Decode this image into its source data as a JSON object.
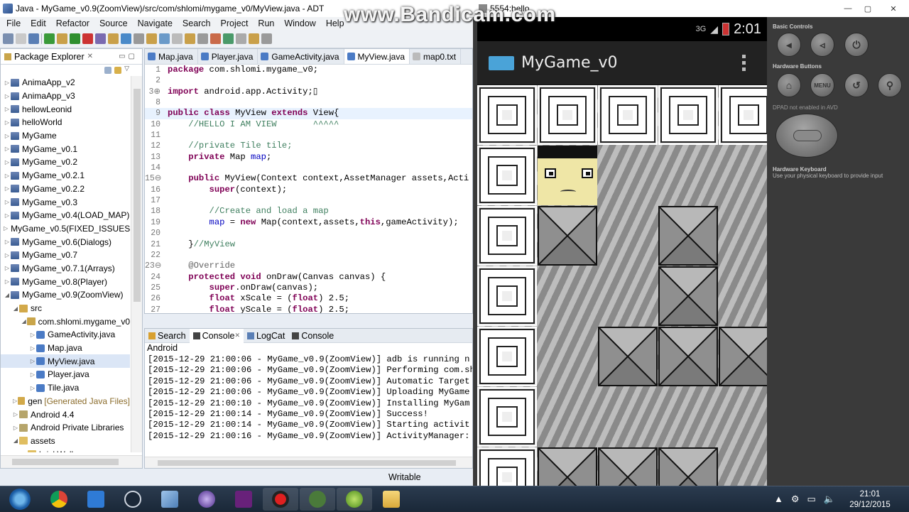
{
  "eclipse": {
    "title": "Java - MyGame_v0.9(ZoomView)/src/com/shlomi/mygame_v0/MyView.java - ADT",
    "menu": [
      "File",
      "Edit",
      "Refactor",
      "Source",
      "Navigate",
      "Search",
      "Project",
      "Run",
      "Window",
      "Help"
    ],
    "package_explorer": {
      "tab_label": "Package Explorer",
      "items": [
        {
          "label": "AnimaApp_v2",
          "kind": "proj",
          "arrow": "▷",
          "indent": 0
        },
        {
          "label": "AnimaApp_v3",
          "kind": "proj",
          "arrow": "▷",
          "indent": 0
        },
        {
          "label": "hellowLeonid",
          "kind": "proj",
          "arrow": "▷",
          "indent": 0
        },
        {
          "label": "helloWorld",
          "kind": "proj",
          "arrow": "▷",
          "indent": 0
        },
        {
          "label": "MyGame",
          "kind": "proj",
          "arrow": "▷",
          "indent": 0
        },
        {
          "label": "MyGame_v0.1",
          "kind": "proj",
          "arrow": "▷",
          "indent": 0
        },
        {
          "label": "MyGame_v0.2",
          "kind": "proj",
          "arrow": "▷",
          "indent": 0
        },
        {
          "label": "MyGame_v0.2.1",
          "kind": "proj",
          "arrow": "▷",
          "indent": 0
        },
        {
          "label": "MyGame_v0.2.2",
          "kind": "proj",
          "arrow": "▷",
          "indent": 0
        },
        {
          "label": "MyGame_v0.3",
          "kind": "proj",
          "arrow": "▷",
          "indent": 0
        },
        {
          "label": "MyGame_v0.4(LOAD_MAP)",
          "kind": "proj",
          "arrow": "▷",
          "indent": 0
        },
        {
          "label": "MyGame_v0.5(FIXED_ISSUES",
          "kind": "proj",
          "arrow": "▷",
          "indent": 0
        },
        {
          "label": "MyGame_v0.6(Dialogs)",
          "kind": "proj",
          "arrow": "▷",
          "indent": 0
        },
        {
          "label": "MyGame_v0.7",
          "kind": "proj",
          "arrow": "▷",
          "indent": 0
        },
        {
          "label": "MyGame_v0.7.1(Arrays)",
          "kind": "proj",
          "arrow": "▷",
          "indent": 0
        },
        {
          "label": "MyGame_v0.8(Player)",
          "kind": "proj",
          "arrow": "▷",
          "indent": 0
        },
        {
          "label": "MyGame_v0.9(ZoomView)",
          "kind": "proj",
          "arrow": "◢",
          "indent": 0
        },
        {
          "label": "src",
          "kind": "src",
          "arrow": "◢",
          "indent": 1
        },
        {
          "label": "com.shlomi.mygame_v0",
          "kind": "pkgf",
          "arrow": "◢",
          "indent": 2
        },
        {
          "label": "GameActivity.java",
          "kind": "java",
          "arrow": "▷",
          "indent": 3
        },
        {
          "label": "Map.java",
          "kind": "java",
          "arrow": "▷",
          "indent": 3
        },
        {
          "label": "MyView.java",
          "kind": "java",
          "arrow": "▷",
          "indent": 3,
          "selected": true
        },
        {
          "label": "Player.java",
          "kind": "java",
          "arrow": "▷",
          "indent": 3
        },
        {
          "label": "Tile.java",
          "kind": "java",
          "arrow": "▷",
          "indent": 3
        },
        {
          "label": "gen",
          "kind": "src",
          "arrow": "▷",
          "indent": 1,
          "suffix": "[Generated Java Files]"
        },
        {
          "label": "Android 4.4",
          "kind": "lib",
          "arrow": "▷",
          "indent": 1
        },
        {
          "label": "Android Private Libraries",
          "kind": "lib",
          "arrow": "▷",
          "indent": 1
        },
        {
          "label": "assets",
          "kind": "folder",
          "arrow": "◢",
          "indent": 1
        },
        {
          "label": "brickWall.png",
          "kind": "folder",
          "arrow": "",
          "indent": 2
        }
      ]
    },
    "editor": {
      "tabs": [
        "Map.java",
        "Player.java",
        "GameActivity.java",
        "MyView.java",
        "map0.txt"
      ],
      "active_tab": 3,
      "lines": [
        {
          "n": "1",
          "segs": [
            [
              "kw",
              "package"
            ],
            [
              "nm",
              " com.shlomi.mygame_v0;"
            ]
          ]
        },
        {
          "n": "2",
          "segs": []
        },
        {
          "n": "3⊕",
          "segs": [
            [
              "kw",
              "import"
            ],
            [
              "nm",
              " android.app.Activity;▯"
            ]
          ]
        },
        {
          "n": "8",
          "segs": []
        },
        {
          "n": "9",
          "segs": [
            [
              "kw",
              "public class"
            ],
            [
              "nm",
              " MyView "
            ],
            [
              "kw",
              "extends"
            ],
            [
              "nm",
              " View{"
            ]
          ],
          "cur": true
        },
        {
          "n": "10",
          "segs": [
            [
              "nm",
              "    "
            ],
            [
              "cm",
              "//HELLO I AM VIEW       ^^^^^"
            ]
          ]
        },
        {
          "n": "11",
          "segs": []
        },
        {
          "n": "12",
          "segs": [
            [
              "nm",
              "    "
            ],
            [
              "cm",
              "//private Tile tile;"
            ]
          ]
        },
        {
          "n": "13",
          "segs": [
            [
              "nm",
              "    "
            ],
            [
              "kw",
              "private"
            ],
            [
              "nm",
              " Map "
            ],
            [
              "fd",
              "map"
            ],
            [
              "nm",
              ";"
            ]
          ]
        },
        {
          "n": "14",
          "segs": []
        },
        {
          "n": "15⊖",
          "segs": [
            [
              "nm",
              "    "
            ],
            [
              "kw",
              "public"
            ],
            [
              "nm",
              " MyView(Context context,AssetManager assets,Acti"
            ]
          ]
        },
        {
          "n": "16",
          "segs": [
            [
              "nm",
              "        "
            ],
            [
              "kw",
              "super"
            ],
            [
              "nm",
              "(context);"
            ]
          ]
        },
        {
          "n": "17",
          "segs": []
        },
        {
          "n": "18",
          "segs": [
            [
              "nm",
              "        "
            ],
            [
              "cm",
              "//Create and load a map"
            ]
          ]
        },
        {
          "n": "19",
          "segs": [
            [
              "nm",
              "        "
            ],
            [
              "fd",
              "map"
            ],
            [
              "nm",
              " = "
            ],
            [
              "kw",
              "new"
            ],
            [
              "nm",
              " Map(context,assets,"
            ],
            [
              "kw",
              "this"
            ],
            [
              "nm",
              ",gameActivity);"
            ]
          ]
        },
        {
          "n": "20",
          "segs": []
        },
        {
          "n": "21",
          "segs": [
            [
              "nm",
              "    }"
            ],
            [
              "cm",
              "//MyView"
            ]
          ]
        },
        {
          "n": "22",
          "segs": []
        },
        {
          "n": "23⊖",
          "segs": [
            [
              "nm",
              "    "
            ],
            [
              "an",
              "@Override"
            ]
          ]
        },
        {
          "n": "24",
          "segs": [
            [
              "nm",
              "    "
            ],
            [
              "kw",
              "protected void"
            ],
            [
              "nm",
              " onDraw(Canvas canvas) {"
            ]
          ]
        },
        {
          "n": "25",
          "segs": [
            [
              "nm",
              "        "
            ],
            [
              "kw",
              "super"
            ],
            [
              "nm",
              ".onDraw(canvas);"
            ]
          ]
        },
        {
          "n": "26",
          "segs": [
            [
              "nm",
              "        "
            ],
            [
              "kw",
              "float"
            ],
            [
              "nm",
              " xScale = ("
            ],
            [
              "kw",
              "float"
            ],
            [
              "nm",
              ") 2.5;"
            ]
          ]
        },
        {
          "n": "27",
          "segs": [
            [
              "nm",
              "        "
            ],
            [
              "kw",
              "float"
            ],
            [
              "nm",
              " yScale = ("
            ],
            [
              "kw",
              "float"
            ],
            [
              "nm",
              ") 2.5;"
            ]
          ]
        }
      ]
    },
    "console": {
      "tabs": [
        "Search",
        "Console",
        "LogCat",
        "Console"
      ],
      "active_tab": 1,
      "label": "Android",
      "lines": [
        "[2015-12-29 21:00:06 - MyGame_v0.9(ZoomView)] adb is running n",
        "[2015-12-29 21:00:06 - MyGame_v0.9(ZoomView)] Performing com.sh",
        "[2015-12-29 21:00:06 - MyGame_v0.9(ZoomView)] Automatic Target",
        "[2015-12-29 21:00:06 - MyGame_v0.9(ZoomView)] Uploading MyGame",
        "[2015-12-29 21:00:10 - MyGame_v0.9(ZoomView)] Installing MyGam",
        "[2015-12-29 21:00:14 - MyGame_v0.9(ZoomView)] Success!",
        "[2015-12-29 21:00:14 - MyGame_v0.9(ZoomView)] Starting activit",
        "[2015-12-29 21:00:16 - MyGame_v0.9(ZoomView)] ActivityManager:"
      ]
    },
    "status": "Writable"
  },
  "watermark": "www.Bandicam.com",
  "emulator": {
    "title": "5554:hello",
    "status_signal": "3G",
    "status_time": "2:01",
    "app_title": "MyGame_v0",
    "side": {
      "basic_controls": "Basic Controls",
      "hardware_buttons": "Hardware Buttons",
      "menu": "MENU",
      "dpad": "DPAD not enabled in AVD",
      "hardware_keyboard": "Hardware Keyboard",
      "keyboard_hint": "Use your physical keyboard to provide input"
    }
  },
  "taskbar": {
    "time": "21:01",
    "date": "29/12/2015"
  }
}
